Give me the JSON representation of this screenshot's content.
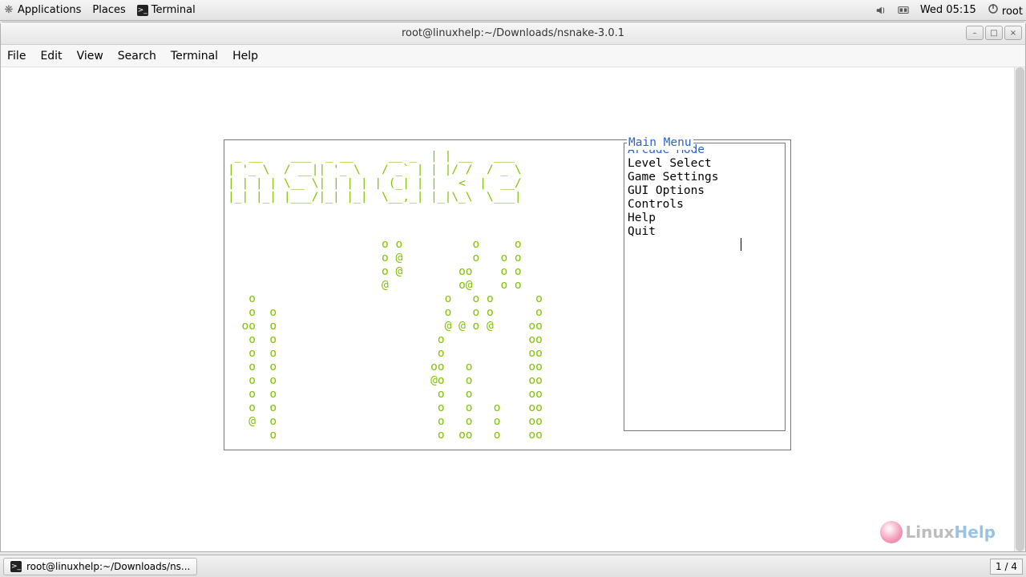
{
  "panel": {
    "applications": "Applications",
    "places": "Places",
    "app_name": "Terminal",
    "clock": "Wed 05:15",
    "user": "root"
  },
  "window": {
    "title": "root@linuxhelp:~/Downloads/nsnake-3.0.1"
  },
  "menubar": {
    "file": "File",
    "edit": "Edit",
    "view": "View",
    "search": "Search",
    "terminal": "Terminal",
    "help": "Help"
  },
  "game": {
    "logo": " _ __    ___  _ __     __ _  | | __   ___ \n| '_ \\  / __|| '_ \\   / _` | | |/ /  / _ \\\n| | | | \\__ \\| | | | | (_| | |   <  |  __/\n|_| |_| |___/|_| |_|  \\__,_| |_|\\_\\  \\___|",
    "dots": "                      o o          o     o\n                      o @          o   o o\n                      o @        oo    o o\n                      @          o@    o o\n   o                           o   o o      o\n   o  o                        o   o o      o\n  oo  o                        @ @ o @     oo\n   o  o                       o            oo\n   o  o                       o            oo\n   o  o                      oo   o        oo\n   o  o                      @o   o        oo\n   o  o                       o   o        oo\n   o  o                       o   o   o    oo\n   @  o                       o   o   o    oo\n      o                       o  oo   o    oo",
    "menu_title": "Main Menu",
    "menu_items": [
      {
        "label": "Arcade Mode",
        "selected": true
      },
      {
        "label": "Level Select",
        "selected": false
      },
      {
        "label": "Game Settings",
        "selected": false
      },
      {
        "label": "GUI Options",
        "selected": false
      },
      {
        "label": "Controls",
        "selected": false
      },
      {
        "label": "Help",
        "selected": false
      },
      {
        "label": "Quit",
        "selected": false
      }
    ]
  },
  "watermark": {
    "a": "Linux",
    "b": "Help"
  },
  "taskbar": {
    "task_label": "root@linuxhelp:~/Downloads/ns...",
    "workspace": "1 / 4"
  }
}
